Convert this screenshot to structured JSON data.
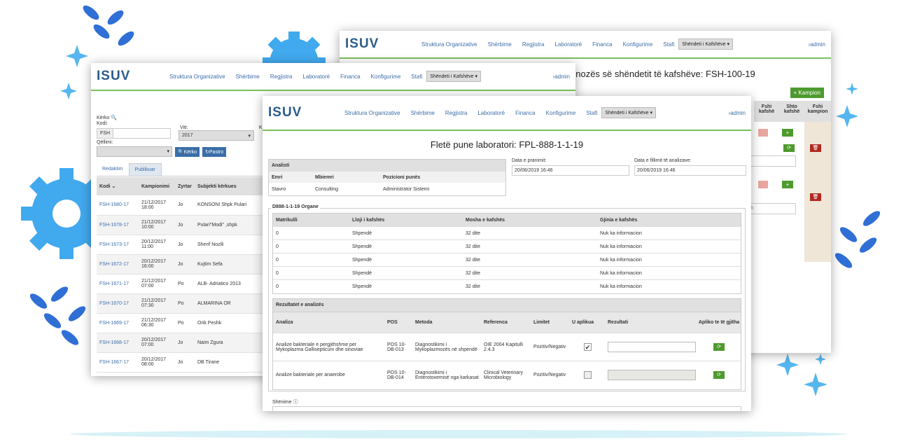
{
  "brand": {
    "logo_text": "ISUV"
  },
  "nav": {
    "items": [
      "Struktura Organizative",
      "Shërbime",
      "Regjistra",
      "Laboratorë",
      "Financa",
      "Konfigurime",
      "Stafi"
    ],
    "dept": "Shëndeti i Kafshëve",
    "user": "admin"
  },
  "back": {
    "title": "gnozës së shëndetit të kafshëve: FSH-100-19",
    "add_btn": "Kampion",
    "headers": [
      "Fshi kafshë",
      "Shto kafshë",
      "Fshi kampion"
    ],
    "placeholder": "k"
  },
  "left": {
    "search": "Kërko",
    "kodi_label": "Kodi:",
    "kodi_prefix": "FSH",
    "viti_label": "Viti:",
    "viti_value": "2017",
    "qellimi_label": "Qëllimi:",
    "btn_search": "Kërko",
    "btn_clear": "Pastro",
    "k_label": "K",
    "tabs": [
      "Redaktim",
      "Publikuar"
    ],
    "cols": [
      "Kodi",
      "Kampionimi",
      "Zyrtar",
      "Subjekti kërkues"
    ],
    "rows": [
      [
        "FSH-1680-17",
        "21/12/2017",
        "18:00",
        "Jo",
        "KONSONI Shpk Pulari"
      ],
      [
        "FSH-1678-17",
        "21/12/2017",
        "10:00",
        "Jo",
        "Pulari\"Modi\" ,shpk"
      ],
      [
        "FSH-1673-17",
        "20/12/2017",
        "11:00",
        "Jo",
        "Sherif Nozlli"
      ],
      [
        "FSH-1672-17",
        "20/12/2017",
        "16:00",
        "Jo",
        "Kujtim Sefa"
      ],
      [
        "FSH-1671-17",
        "21/12/2017",
        "07:00",
        "Po",
        "ALB- Adriatico 2013"
      ],
      [
        "FSH-1670-17",
        "21/12/2017",
        "07:30",
        "Po",
        "ALMARINA OR"
      ],
      [
        "FSH-1669-17",
        "21/12/2017",
        "06:30",
        "Po",
        "Orik Peshk"
      ],
      [
        "FSH-1668-17",
        "20/12/2017",
        "07:00",
        "Jo",
        "Naim Zgura"
      ],
      [
        "FSH-1667-17",
        "20/12/2017",
        "08:00",
        "Jo",
        "DB Tirane"
      ]
    ]
  },
  "front": {
    "title": "Fletë pune laboratori: FPL-888-1-1-19",
    "analyst": {
      "section": "Analisti",
      "cols": [
        "Emri",
        "Mbiemri",
        "Pozicioni punës"
      ],
      "row": [
        "Stavro",
        "Consulting",
        "Administrator Sistemi"
      ]
    },
    "date_received_label": "Data e pranimit:",
    "date_received": "20/06/2019 16:46",
    "date_start_label": "Data e fillimit të analizave:",
    "date_start": "20/06/2019 16:46",
    "organ": {
      "legend": "D888-1-1-19 Organe",
      "cols": [
        "Matrikulli",
        "Lloji i kafshës",
        "Mosha e kafshës",
        "Gjinia e kafshës"
      ],
      "rows": [
        [
          "0",
          "Shpendë",
          "32 dite",
          "Nuk ka informacion"
        ],
        [
          "0",
          "Shpendë",
          "32 dite",
          "Nuk ka informacion"
        ],
        [
          "0",
          "Shpendë",
          "32 dite",
          "Nuk ka informacion"
        ],
        [
          "0",
          "Shpendë",
          "32 dite",
          "Nuk ka informacion"
        ],
        [
          "0",
          "Shpendë",
          "32 dite",
          "Nuk ka informacion"
        ]
      ]
    },
    "results": {
      "section": "Rezultatet e analizës",
      "cols": [
        "Analiza",
        "POS",
        "Metoda",
        "Referenca",
        "Limitet",
        "U aplikua",
        "Rezultati",
        "Apliko te të gjitha"
      ],
      "rows": [
        {
          "analiza": "Analize bakteriale e pergjithshme per Mykoplazma Gallisepticum dhe sinoviae",
          "pos": "POS 10-DB-013",
          "metoda": "Diagnostikimi i Mykoplazmozës në shpendë",
          "ref": "OIE 2004 Kapitulli 2.4.3",
          "lim": "Pozitiv/Negativ",
          "checked": true
        },
        {
          "analiza": "Analize bakteriale per anaerobe",
          "pos": "POS 10-DB-014",
          "metoda": "Diagnostikimi i Enterotoxemisë nga karkasat",
          "ref": "Clinical Veterinary Microbiology",
          "lim": "Pozitiv/Negativ",
          "checked": false
        }
      ]
    },
    "notes": "Shënime"
  },
  "icons": [
    "search-icon",
    "sort-icon",
    "refresh-icon",
    "check-icon",
    "trash-icon",
    "plus-icon",
    "info-icon",
    "dropdown-icon",
    "leaf-icon",
    "sparkle-icon",
    "gear-icon"
  ],
  "colors": {
    "link": "#3d6ea8",
    "accent_green": "#7bbf5a",
    "btn_green": "#4d9a2e",
    "btn_red": "#b02a20",
    "btn_blue": "#3a6ea8",
    "decor_blue": "#2f6fd6"
  }
}
